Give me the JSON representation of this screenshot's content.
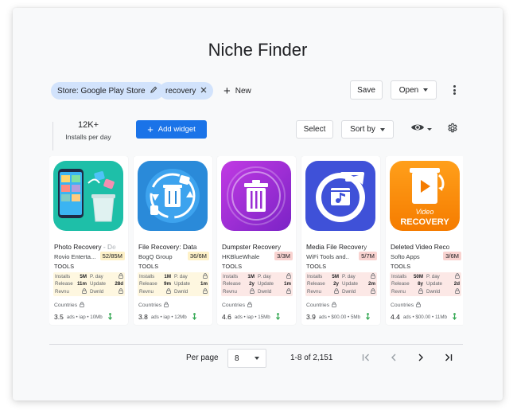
{
  "title": "Niche Finder",
  "filters": {
    "store_chip": "Store: Google Play Store",
    "keyword_chip": "recovery",
    "new_label": "New"
  },
  "toolbar": {
    "save_label": "Save",
    "open_label": "Open"
  },
  "stats": {
    "installs_value": "12K+",
    "installs_label": "Installs per day"
  },
  "controls": {
    "add_widget_label": "Add widget",
    "select_label": "Select",
    "sort_label": "Sort by"
  },
  "metric_labels": {
    "installs": "Installs",
    "release": "Release",
    "revenue": "Revnu",
    "per_day": "P. day",
    "update": "Update",
    "download": "Dwnld",
    "countries": "Countries"
  },
  "apps": [
    {
      "name_main": "Photo Recovery",
      "name_tail": " - De",
      "developer": "Rovio Enterta...",
      "rank": "52/85M",
      "category": "TOOLS",
      "installs": "5M",
      "release": "11m",
      "update": "28d",
      "rating": "3.5",
      "footer": "ads • iap • 10Mb",
      "theme": "yellow",
      "icon": "photo-recovery-icon"
    },
    {
      "name_main": "File Recovery: Data",
      "name_tail": "",
      "developer": "BogQ Group",
      "rank": "36/6M",
      "category": "TOOLS",
      "installs": "1M",
      "release": "9m",
      "update": "1m",
      "rating": "3.8",
      "footer": "ads • iap • 12Mb",
      "theme": "yellow",
      "icon": "file-recovery-icon"
    },
    {
      "name_main": "Dumpster Recovery",
      "name_tail": "",
      "developer": "HKBlueWhale",
      "rank": "3/3M",
      "category": "TOOLS",
      "installs": "1M",
      "release": "2y",
      "update": "1m",
      "rating": "4.6",
      "footer": "ads • iap • 15Mb",
      "theme": "red",
      "icon": "dumpster-icon"
    },
    {
      "name_main": "Media File Recovery",
      "name_tail": "",
      "developer": "WiFi Tools and...",
      "rank": "5/7M",
      "category": "TOOLS",
      "installs": "5M",
      "release": "2y",
      "update": "2m",
      "rating": "3.9",
      "footer": "ads • $00.00 • 5Mb",
      "theme": "red",
      "icon": "media-recovery-icon"
    },
    {
      "name_main": "Deleted Video Reco",
      "name_tail": "",
      "developer": "Softo Apps",
      "rank": "3/6M",
      "category": "TOOLS",
      "installs": "50M",
      "release": "8y",
      "update": "2d",
      "rating": "4.4",
      "footer": "ads • $00.00 • 11Mb",
      "theme": "red",
      "icon": "video-recovery-icon",
      "icon_text": "Video\nRECOVERY"
    }
  ],
  "pagination": {
    "per_page_label": "Per page",
    "per_page_value": "8",
    "range": "1-8 of 2,151"
  },
  "colors": {
    "accent": "#1a73e8",
    "chip": "#d2e3fc",
    "yellow_bg": "#fef7e0",
    "yellow_rank": "#fef1c7",
    "red_bg": "#fce8e6",
    "red_rank": "#f9d3d0"
  }
}
